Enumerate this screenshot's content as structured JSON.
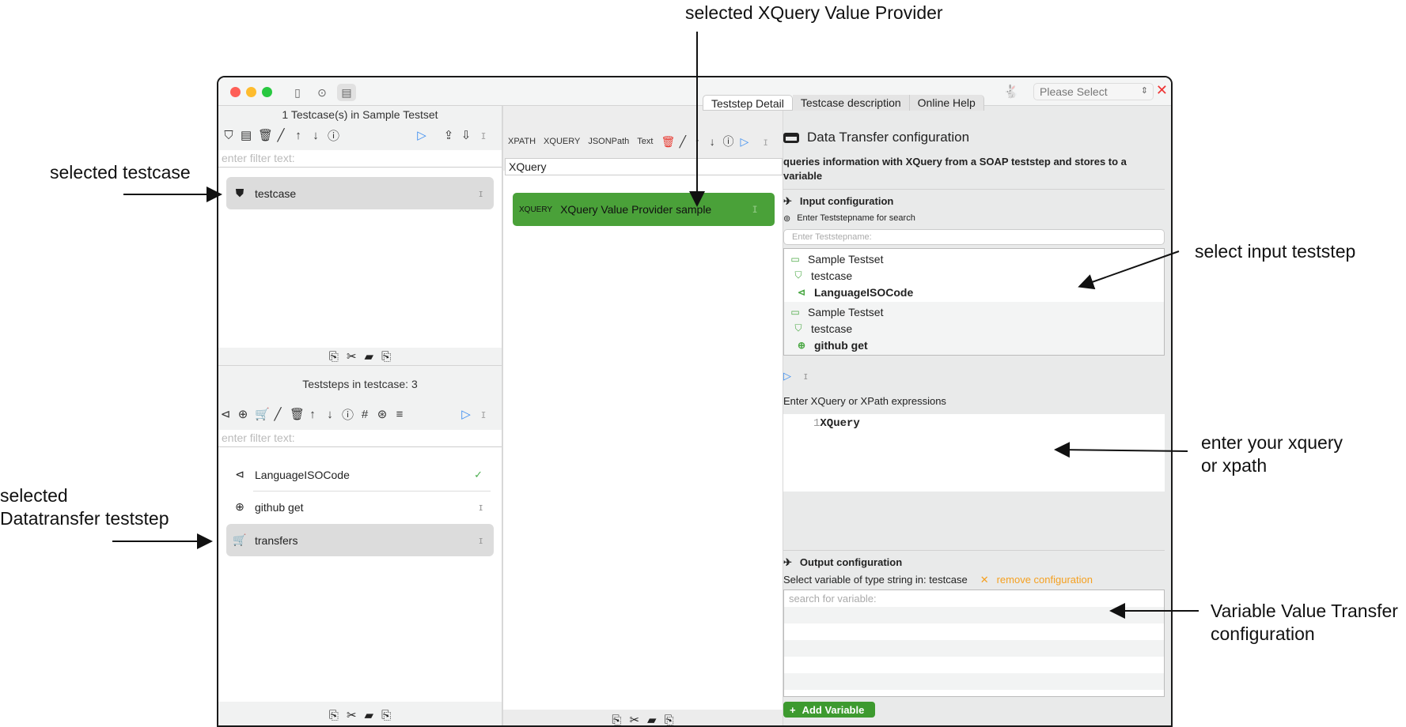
{
  "annotations": {
    "top": "selected XQuery Value Provider",
    "selected_testcase": "selected testcase",
    "selected_datatransfer_line1": "selected",
    "selected_datatransfer_line2": "Datatransfer teststep",
    "select_input": "select input teststep",
    "enter_xquery_line1": "enter your xquery",
    "enter_xquery_line2": "or xpath",
    "variable_transfer_line1": "Variable Value Transfer",
    "variable_transfer_line2": "configuration"
  },
  "titlebar": {
    "select_value": "Please Select",
    "icons": [
      "sidebar-toggle-icon",
      "network-icon",
      "document-icon",
      "rabbit-icon",
      "close-icon"
    ]
  },
  "left": {
    "testcase_header": "1 Testcase(s) in Sample Testset",
    "testcase_filter_placeholder": "enter filter text:",
    "testcases": [
      {
        "label": "testcase"
      }
    ],
    "teststeps_header": "Teststeps in testcase: 3",
    "teststep_filter_placeholder": "enter filter text:",
    "teststeps": [
      {
        "label": "LanguageISOCode",
        "status": "✓"
      },
      {
        "label": "github get",
        "status": ""
      },
      {
        "label": "transfers",
        "status": ""
      }
    ]
  },
  "middle": {
    "toolbar_labels": [
      "XPATH",
      "XQUERY",
      "JSONPath",
      "Text"
    ],
    "input_value": "XQuery",
    "provider": {
      "type": "XQUERY",
      "label": "XQuery Value Provider sample"
    }
  },
  "right": {
    "tabs": [
      "Teststep Detail",
      "Testcase description",
      "Online Help"
    ],
    "title": "Data Transfer configuration",
    "description": "queries information with XQuery from a SOAP teststep and stores to a variable",
    "input_section": "Input configuration",
    "search_label": "Enter Teststepname for search",
    "search_placeholder": "Enter Teststepname:",
    "tree": [
      {
        "testset": "Sample Testset",
        "testcase": "testcase",
        "step": "LanguageISOCode"
      },
      {
        "testset": "Sample Testset",
        "testcase": "testcase",
        "step": "github get"
      }
    ],
    "expr_label": "Enter XQuery or XPath expressions",
    "expr_line_number": "1",
    "expr_value": "XQuery",
    "output_section": "Output configuration",
    "output_label": "Select variable of type string in: testcase",
    "remove_config": "remove configuration",
    "variable_placeholder": "search for variable:",
    "add_variable": "Add Variable"
  },
  "colors": {
    "accent_green": "#4aa139",
    "orange": "#f5a020",
    "blue": "#3a8cf0",
    "red": "#e8382f"
  }
}
